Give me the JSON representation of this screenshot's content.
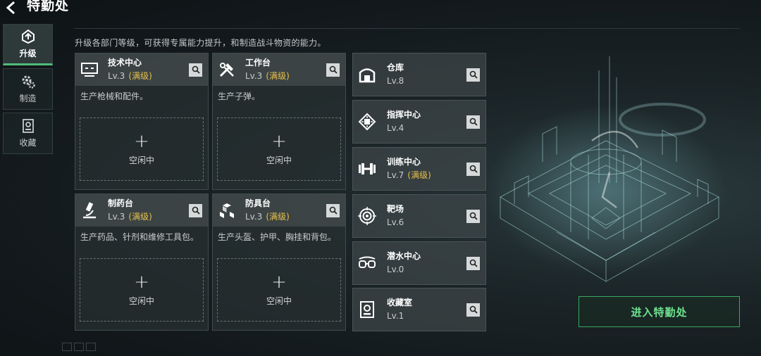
{
  "header": {
    "title": "特勤处"
  },
  "sidebar": {
    "tabs": [
      {
        "label": "升级",
        "icon": "upgrade-icon",
        "active": true
      },
      {
        "label": "制造",
        "icon": "gears-icon",
        "active": false
      },
      {
        "label": "收藏",
        "icon": "collection-icon",
        "active": false
      }
    ]
  },
  "description": "升级各部门等级，可获得专属能力提升，和制造战斗物资的能力。",
  "big_cards": [
    {
      "name": "技术中心",
      "level": "Lv.3",
      "max": "(满级)",
      "desc": "生产枪械和配件。",
      "slot_label": "空闲中",
      "plus": "+",
      "icon": "monitor-icon"
    },
    {
      "name": "工作台",
      "level": "Lv.3",
      "max": "(满级)",
      "desc": "生产子弹。",
      "slot_label": "空闲中",
      "plus": "+",
      "icon": "tools-icon"
    },
    {
      "name": "制药台",
      "level": "Lv.3",
      "max": "(满级)",
      "desc": "生产药品、针剂和维修工具包。",
      "slot_label": "空闲中",
      "plus": "+",
      "icon": "microscope-icon"
    },
    {
      "name": "防具台",
      "level": "Lv.3",
      "max": "(满级)",
      "desc": "生产头盔、护甲、胸挂和背包。",
      "slot_label": "空闲中",
      "plus": "+",
      "icon": "cubes-icon"
    }
  ],
  "small_cards": [
    {
      "name": "仓库",
      "level": "Lv.8",
      "max": "",
      "icon": "warehouse-icon"
    },
    {
      "name": "指挥中心",
      "level": "Lv.4",
      "max": "",
      "icon": "chip-icon"
    },
    {
      "name": "训练中心",
      "level": "Lv.7",
      "max": "(满级)",
      "icon": "dumbbell-icon"
    },
    {
      "name": "靶场",
      "level": "Lv.6",
      "max": "",
      "icon": "target-icon"
    },
    {
      "name": "潜水中心",
      "level": "Lv.0",
      "max": "",
      "icon": "goggles-icon"
    },
    {
      "name": "收藏室",
      "level": "Lv.1",
      "max": "",
      "icon": "safe-icon"
    }
  ],
  "enter_button": "进入特勤处",
  "colors": {
    "accent_green": "#4fbb7a",
    "max_level_yellow": "#e7c04a",
    "enter_text": "#6ee18f"
  }
}
